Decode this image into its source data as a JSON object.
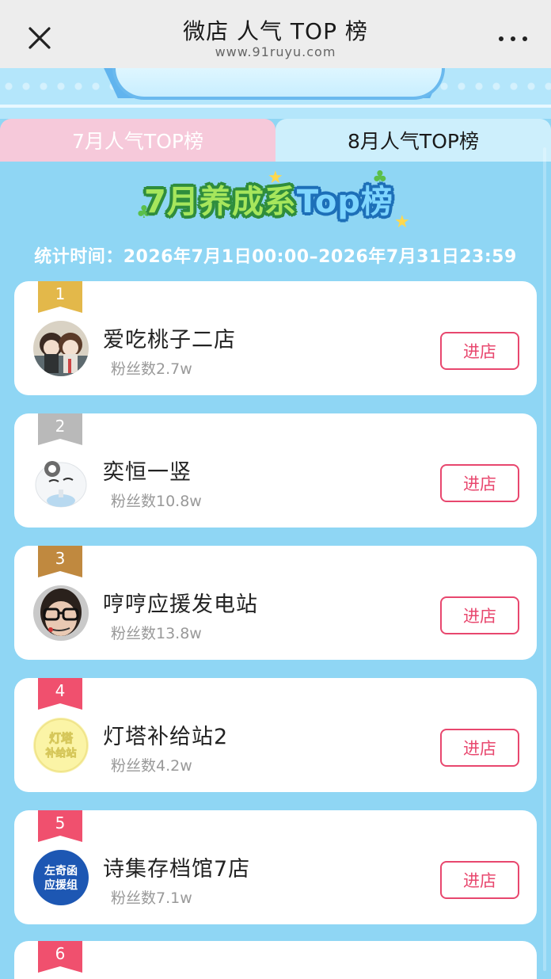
{
  "topbar": {
    "title": "微店 人气 TOP 榜",
    "url": "www.91ruyu.com"
  },
  "tabs": [
    {
      "label": "7月人气TOP榜",
      "selected": true
    },
    {
      "label": "8月人气TOP榜",
      "selected": false
    }
  ],
  "header": {
    "logo_text": "7月养成系",
    "logo_highlight": "Top榜",
    "period": "统计时间：2026年7月1日00:00–2026年7月31日23:59"
  },
  "colors": {
    "accent": "#e8476e",
    "background": "#8fd6f4",
    "tab_active_bg": "#f6c9da",
    "tab_inactive_bg": "#cdeffc",
    "rank_gold": "#e3b84a",
    "rank_silver": "#b9b9b9",
    "rank_bronze": "#c0893f",
    "rank_other": "#f0506e"
  },
  "enter_label": "进店",
  "stores": [
    {
      "rank": "1",
      "name": "爱吃桃子二店",
      "fans": "粉丝数2.7w",
      "avatar_icon": "two-dolls-avatar"
    },
    {
      "rank": "2",
      "name": "奕恒一竖",
      "fans": "粉丝数10.8w",
      "avatar_icon": "cartoon-face-avatar"
    },
    {
      "rank": "3",
      "name": "哼哼应援发电站",
      "fans": "粉丝数13.8w",
      "avatar_icon": "glasses-person-avatar"
    },
    {
      "rank": "4",
      "name": "灯塔补给站2",
      "fans": "粉丝数4.2w",
      "avatar_icon": "lighthouse-logo-avatar"
    },
    {
      "rank": "5",
      "name": "诗集存档馆7店",
      "fans": "粉丝数7.1w",
      "avatar_icon": "support-group-logo-avatar"
    },
    {
      "rank": "6",
      "name": "",
      "fans": ""
    }
  ],
  "avatar_text": {
    "store4": [
      "灯塔",
      "补给站"
    ],
    "store5": [
      "左奇函",
      "应援组"
    ]
  }
}
